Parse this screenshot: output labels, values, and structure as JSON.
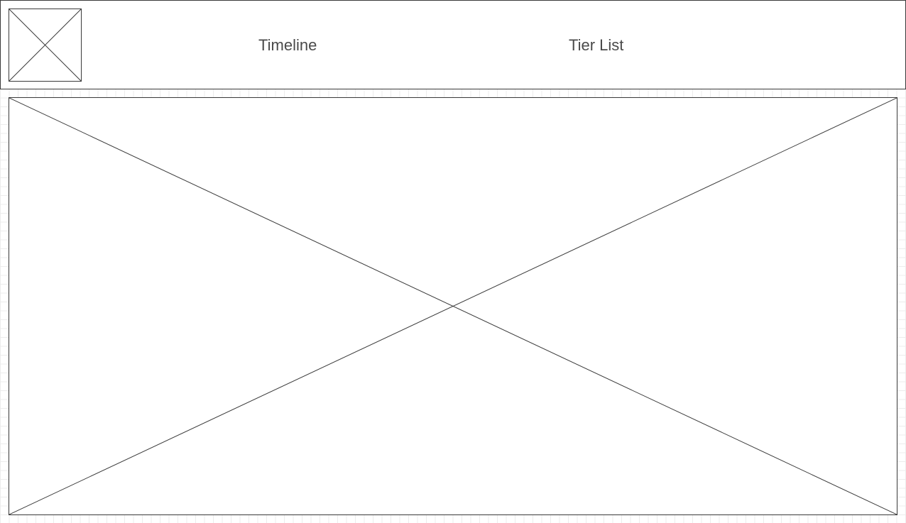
{
  "header": {
    "logo_icon": "image-placeholder-icon",
    "nav": {
      "timeline_label": "Timeline",
      "tier_list_label": "Tier List"
    }
  },
  "main": {
    "hero_icon": "image-placeholder-icon"
  },
  "colors": {
    "stroke": "#3a3a3a",
    "text": "#4a4a4a",
    "grid": "#ececec",
    "background": "#ffffff"
  }
}
